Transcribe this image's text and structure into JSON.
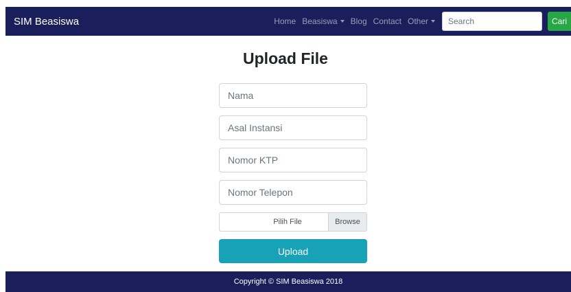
{
  "navbar": {
    "brand": "SIM Beasiswa",
    "links": [
      {
        "label": "Home"
      },
      {
        "label": "Beasiswa"
      },
      {
        "label": "Blog"
      },
      {
        "label": "Contact"
      },
      {
        "label": "Other"
      }
    ],
    "search_placeholder": "Search",
    "search_button": "Cari"
  },
  "main": {
    "title": "Upload File",
    "fields": {
      "nama": "Nama",
      "asal_instansi": "Asal Instansi",
      "nomor_ktp": "Nomor KTP",
      "nomor_telepon": "Nomor Telepon"
    },
    "file": {
      "label": "Pilih File",
      "browse": "Browse"
    },
    "upload_button": "Upload"
  },
  "footer": {
    "text": "Copyright © SIM Beasiswa 2018"
  },
  "colors": {
    "navbar_bg": "#1a1f5c",
    "search_button_bg": "#28a745",
    "upload_button_bg": "#17a2b8"
  }
}
